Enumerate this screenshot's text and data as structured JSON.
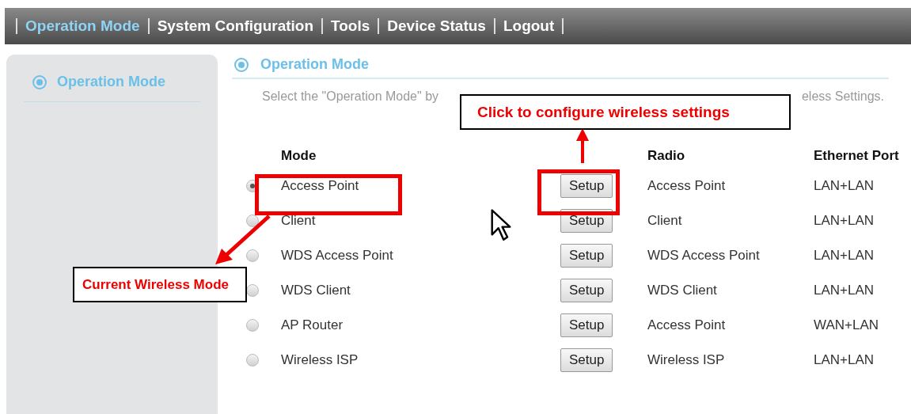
{
  "nav": [
    {
      "label": "Operation Mode",
      "selected": true
    },
    {
      "label": "System Configuration",
      "selected": false
    },
    {
      "label": "Tools",
      "selected": false
    },
    {
      "label": "Device Status",
      "selected": false
    },
    {
      "label": "Logout",
      "selected": false
    }
  ],
  "sidebar": {
    "title": "Operation Mode"
  },
  "main": {
    "title": "Operation Mode",
    "intro_start": "Select the \"Operation Mode\" by",
    "intro_end": "eless Settings."
  },
  "table": {
    "mode_header": "Mode",
    "radio_header": "Radio",
    "ethernet_header": "Ethernet Port",
    "rows": [
      {
        "selected": true,
        "mode": "Access Point",
        "button": "Setup",
        "radio": "Access Point",
        "ethernet": "LAN+LAN"
      },
      {
        "selected": false,
        "mode": "Client",
        "button": "Setup",
        "radio": "Client",
        "ethernet": "LAN+LAN"
      },
      {
        "selected": false,
        "mode": "WDS Access Point",
        "button": "Setup",
        "radio": "WDS Access Point",
        "ethernet": "LAN+LAN"
      },
      {
        "selected": false,
        "mode": "WDS Client",
        "button": "Setup",
        "radio": "WDS Client",
        "ethernet": "LAN+LAN"
      },
      {
        "selected": false,
        "mode": "AP Router",
        "button": "Setup",
        "radio": "Access Point",
        "ethernet": "WAN+LAN"
      },
      {
        "selected": false,
        "mode": "Wireless ISP",
        "button": "Setup",
        "radio": "Wireless ISP",
        "ethernet": "LAN+LAN"
      }
    ]
  },
  "annotations": [
    {
      "text": "Click to configure wireless settings"
    },
    {
      "text": "Current Wireless Mode"
    }
  ]
}
